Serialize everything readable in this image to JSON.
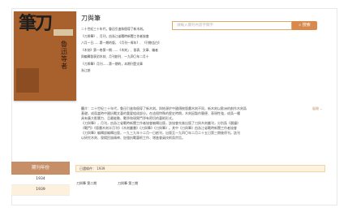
{
  "book": {
    "cover_title": "筆刀",
    "cover_vertical": "魯迅等者",
    "title": "刀與筆"
  },
  "search": {
    "placeholder": "請輸入關刊內容字關字",
    "button_label": "搜索"
  },
  "toc": [
    "二十世紀三十年代，魯迅引進和倡導了新木刻。",
    "《刀與筆》、月刊，由浙江省戰時新聞工作者協會",
    "八月一日……第一期的版，《月刊一周年》、《刊物告白》",
    "《木刻》第一卷第一期……《木刻」、發表、文章、編者",
    "與編輯發表對木刻、月刊創刊、一九四〇年二月十",
    "《刀與筆》月刊……第一期的，本期刊登文章",
    "浙江創"
  ],
  "summary": {
    "label": "簡介：",
    "lines": [
      "二十世紀三十年代，魯迅引進和倡導了新木刻。與結源於中國傳統版畫木刻不同，新木刻以歐洲的創作木刻爲",
      "基礎，成爲當時中國抗戰文藝的重要組成部分。在這個特殊的歷史時期，木刻因製作簡便、表現性強，成爲一種",
      "具有廣大影響力、且最能動、戰爭和現實鬥爭有密切的藝術形式。",
      "《刀與筆》，月刊，由浙江省戰時新聞工作者協會編輯出版，該協會先後出版了刀與木刻叢刊，分別爲《晨鐘》",
      "《戰鬥》《版畫木刻半月刊》《木刻叢書》《刀與筆》《刀與筆》。其中《刀與筆》由浙江省戰時新聞工作者協會",
      "《刀與筆》編輯部編輯出版，一九三九年十二月一日創刊，出版至一九四〇年二月二十五日第三期後停刊。該刊",
      "以研究木刻、發揚民族精神、加強抗戰藝術工作、增進會員技術爲宗旨。"
    ],
    "expand_label": "展開 ⌄"
  },
  "sidebar": {
    "title": "期刊年份",
    "years": [
      "1934",
      "1939"
    ]
  },
  "selected": {
    "label": "已選條件：",
    "value": "1939"
  },
  "issues": [
    "刀與筆 第二期",
    "刀與筆 第三期"
  ],
  "colors": {
    "accent": "#d9894c",
    "sidebar_head": "#c78f67",
    "highlight": "#fdf1dd"
  }
}
